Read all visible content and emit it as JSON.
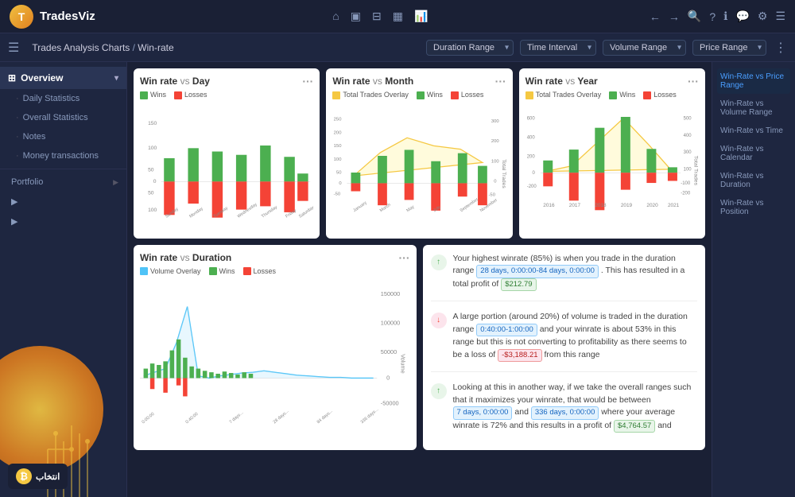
{
  "app": {
    "name": "TradesViz",
    "logo_char": "T"
  },
  "topnav": {
    "icons": [
      "⌂",
      "▣",
      "⊟",
      "▦",
      "📊"
    ],
    "right_icons": [
      "←",
      "→",
      "🔍",
      "?",
      "ℹ",
      "💬",
      "⚙",
      "☰"
    ]
  },
  "breadcrumb": {
    "main": "Trades Analysis Charts",
    "sub": "Win-rate"
  },
  "filters": [
    {
      "label": "Duration Range",
      "value": "Duration Range"
    },
    {
      "label": "Time Interval",
      "value": "Time Interval"
    },
    {
      "label": "Volume Range",
      "value": "Volume Range"
    },
    {
      "label": "Price Range",
      "value": "Price Range"
    }
  ],
  "sidebar": {
    "overview_label": "Overview",
    "items": [
      {
        "label": "Daily Statistics",
        "active": false
      },
      {
        "label": "Overall Statistics",
        "active": false
      },
      {
        "label": "Notes",
        "active": false
      },
      {
        "label": "Money transactions",
        "active": false
      },
      {
        "label": "Portfolio",
        "hasArrow": true
      }
    ]
  },
  "right_sidebar": {
    "items": [
      {
        "label": "Win-Rate vs Price Range",
        "active": true
      },
      {
        "label": "Win-Rate vs Volume Range",
        "active": false
      },
      {
        "label": "Win-Rate vs Time",
        "active": false
      },
      {
        "label": "Win-Rate vs Calendar",
        "active": false
      },
      {
        "label": "Win-Rate vs Duration",
        "active": false
      },
      {
        "label": "Win-Rate vs Position",
        "active": false
      }
    ]
  },
  "charts": {
    "top": [
      {
        "title": "Win rate",
        "vs": "vs",
        "subtitle": "Day",
        "legend": [
          {
            "label": "Wins",
            "color": "#4caf50"
          },
          {
            "label": "Losses",
            "color": "#f44336"
          }
        ],
        "type": "bar",
        "xLabels": [
          "Sunday",
          "Monday",
          "Tuesday",
          "Wednesday",
          "Thursday",
          "Friday",
          "Saturday"
        ],
        "yMax": 150,
        "yMin": -150,
        "wins": [
          80,
          120,
          110,
          95,
          130,
          90,
          30
        ],
        "losses": [
          -120,
          -80,
          -130,
          -100,
          -90,
          -110,
          -70
        ]
      },
      {
        "title": "Win rate",
        "vs": "vs",
        "subtitle": "Month",
        "legend": [
          {
            "label": "Total Trades Overlay",
            "color": "#f5c842"
          },
          {
            "label": "Wins",
            "color": "#4caf50"
          },
          {
            "label": "Losses",
            "color": "#f44336"
          }
        ],
        "type": "bar_overlay",
        "xLabels": [
          "January",
          "March",
          "May",
          "July",
          "September",
          "November"
        ],
        "yAxisRight": "Total Trades",
        "wins": [
          40,
          100,
          120,
          80,
          110,
          60
        ],
        "losses": [
          -30,
          -80,
          -60,
          -100,
          -50,
          -80
        ],
        "overlay": [
          80,
          200,
          250,
          220,
          180,
          150
        ]
      },
      {
        "title": "Win rate",
        "vs": "vs",
        "subtitle": "Year",
        "legend": [
          {
            "label": "Total Trades Overlay",
            "color": "#f5c842"
          },
          {
            "label": "Wins",
            "color": "#4caf50"
          },
          {
            "label": "Losses",
            "color": "#f44336"
          }
        ],
        "type": "bar_overlay",
        "xLabels": [
          "2016",
          "2017",
          "2018",
          "2019",
          "2020",
          "2021"
        ],
        "yAxisRight": "Total Trades",
        "wins": [
          100,
          200,
          400,
          600,
          300,
          50
        ],
        "losses": [
          -50,
          -100,
          -200,
          -300,
          -150,
          -30
        ],
        "overlay": [
          150,
          300,
          600,
          900,
          450,
          80
        ]
      }
    ],
    "bottom_left": {
      "title": "Win rate",
      "vs": "vs",
      "subtitle": "Duration",
      "legend": [
        {
          "label": "Volume Overlay",
          "color": "#4fc3f7"
        },
        {
          "label": "Wins",
          "color": "#4caf50"
        },
        {
          "label": "Losses",
          "color": "#f44336"
        }
      ],
      "yAxisRight": "Volume",
      "yRightLabels": [
        "150000",
        "100000",
        "50000",
        "0",
        "-50000"
      ]
    }
  },
  "insights": [
    {
      "type": "green",
      "icon": "↑",
      "text": "Your highest winrate (85%) is when you trade in the duration range",
      "badge1": "28 days, 0:00:00-84 days, 0:00:00",
      "badge1_type": "blue",
      "text2": ". This has resulted in a total profit of",
      "badge2": "$212.79",
      "badge2_type": "green"
    },
    {
      "type": "red",
      "icon": "↓",
      "text": "A large portion (around 20%) of volume is traded in the duration range",
      "badge1": "0:40:00-1:00:00",
      "badge1_type": "blue",
      "text2": "and your winrate is about 53% in this range but this is not converting to profitability as there seems to be a loss of",
      "badge2": "-$3,188.21",
      "badge2_type": "red",
      "text3": "from this range"
    },
    {
      "type": "green",
      "icon": "↑",
      "text": "Looking at this in another way, if we take the overall ranges such that it maximizes your winrate, that would be between",
      "badge1": "7 days, 0:00:00",
      "badge1_type": "blue",
      "text2": "and",
      "badge2": "336 days, 0:00:00",
      "badge2_type": "blue",
      "text3": "where your average winrate is 72% and this results in a profit of",
      "badge3": "$4,764.57",
      "badge3_type": "green",
      "text4": "and"
    }
  ]
}
